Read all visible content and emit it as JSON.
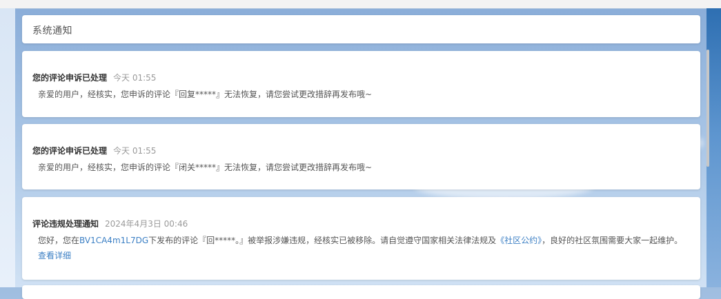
{
  "header": {
    "title": "系统通知"
  },
  "messages": [
    {
      "title": "您的评论申诉已处理",
      "time": "今天 01:55",
      "body": "亲爱的用户，经核实，您申诉的评论『回复*****』无法恢复，请您尝试更改措辞再发布哦~"
    },
    {
      "title": "您的评论申诉已处理",
      "time": "今天 01:55",
      "body": "亲爱的用户，经核实，您申诉的评论『闭关*****』无法恢复，请您尝试更改措辞再发布哦~"
    },
    {
      "title": "评论违规处理通知",
      "time": "2024年4月3日 00:46",
      "body_prefix": "您好，您在",
      "video_link": "BV1CA4m1L7DG",
      "body_middle": "下发布的评论『回*****。』被举报涉嫌违规，经核实已被移除。请自觉遵守国家相关法律法规及",
      "rules_link": "《社区公约》",
      "body_suffix": "，良好的社区氛围需要大家一起维护。",
      "detail_link": "查看详细"
    }
  ],
  "colors": {
    "link": "#3b7fc4",
    "title": "#333333",
    "time": "#9a9a9a",
    "body": "#555555"
  }
}
